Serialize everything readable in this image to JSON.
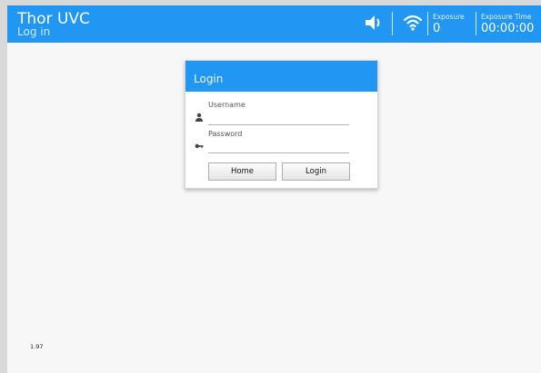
{
  "header": {
    "app_title": "Thor UVC",
    "screen_name": "Log in",
    "icons": [
      "speaker-icon",
      "wifi-icon"
    ],
    "exposure": {
      "label": "Exposure",
      "value": "0"
    },
    "exposure_time": {
      "label": "Exposure Time",
      "value": "00:00:00"
    },
    "accent_color": "#2196f3"
  },
  "login": {
    "title": "Login",
    "username": {
      "label": "Username",
      "value": "",
      "icon": "user-icon"
    },
    "password": {
      "label": "Password",
      "value": "",
      "icon": "key-icon"
    },
    "home_button": "Home",
    "login_button": "Login"
  },
  "footer": {
    "version": "1.97"
  }
}
